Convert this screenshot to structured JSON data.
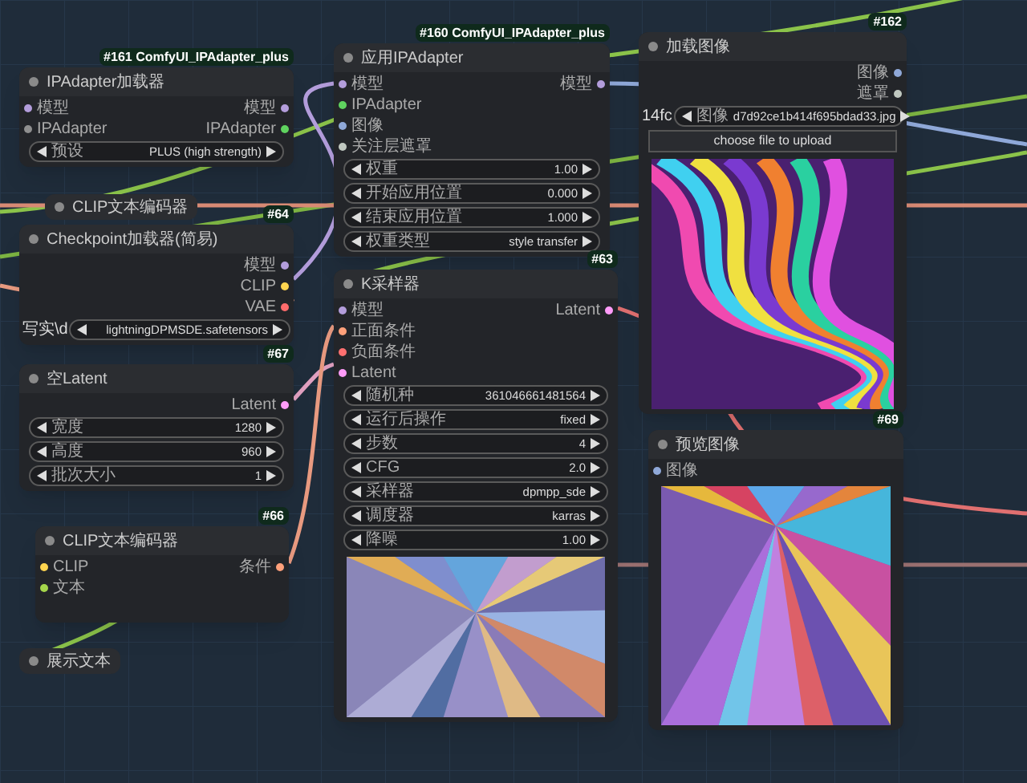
{
  "nodes": [
    {
      "kind": "node",
      "badge": "#161 ComfyUI_IPAdapter_plus",
      "title": "IPAdapter加载器",
      "inputs": [
        {
          "label": "模型",
          "color": "#b39ddb"
        },
        {
          "label": "IPAdapter",
          "color": "#8f8f8f"
        }
      ],
      "outputs": [
        {
          "label": "模型",
          "color": "#b39ddb"
        },
        {
          "label": "IPAdapter",
          "color": "#5fd35f"
        }
      ],
      "widgets": [
        {
          "label": "预设",
          "value": "PLUS (high strength)"
        }
      ]
    },
    {
      "kind": "node",
      "badge": "#160 ComfyUI_IPAdapter_plus",
      "title": "应用IPAdapter",
      "inputs": [
        {
          "label": "模型",
          "color": "#b39ddb"
        },
        {
          "label": "IPAdapter",
          "color": "#5fd35f"
        },
        {
          "label": "图像",
          "color": "#8fa8d8"
        },
        {
          "label": "关注层遮罩",
          "color": "#c0c8c0"
        }
      ],
      "outputs": [
        {
          "label": "模型",
          "color": "#b39ddb"
        }
      ],
      "widgets": [
        {
          "label": "权重",
          "value": "1.00"
        },
        {
          "label": "开始应用位置",
          "value": "0.000"
        },
        {
          "label": "结束应用位置",
          "value": "1.000"
        },
        {
          "label": "权重类型",
          "value": "style transfer"
        }
      ]
    },
    {
      "kind": "node",
      "badge": "#162",
      "title": "加载图像",
      "outputs": [
        {
          "label": "图像",
          "color": "#8fa8d8"
        },
        {
          "label": "遮罩",
          "color": "#c0c8c0"
        }
      ],
      "widgets": [
        {
          "prefix": "14fc",
          "label": "图像",
          "value": "d7d92ce1b414f695bdad33.jpg"
        }
      ],
      "button": "choose file to upload",
      "image": {
        "kind": "picture"
      }
    },
    {
      "kind": "collapsed",
      "title": "CLIP文本编码器"
    },
    {
      "kind": "node",
      "badge": "#64",
      "title": "Checkpoint加载器(简易)",
      "outputs": [
        {
          "label": "模型",
          "color": "#b39ddb"
        },
        {
          "label": "CLIP",
          "color": "#ffd54f"
        },
        {
          "label": "VAE",
          "color": "#ff6b6b"
        }
      ],
      "widgets": [
        {
          "prefix": "写实\\d",
          "value": "lightningDPMSDE.safetensors"
        }
      ]
    },
    {
      "kind": "node",
      "badge": "#67",
      "title": "空Latent",
      "outputs": [
        {
          "label": "Latent",
          "color": "#ff9cf9"
        }
      ],
      "widgets": [
        {
          "label": "宽度",
          "value": "1280"
        },
        {
          "label": "高度",
          "value": "960"
        },
        {
          "label": "批次大小",
          "value": "1"
        }
      ]
    },
    {
      "kind": "node",
      "badge": "#66",
      "title": "CLIP文本编码器",
      "inputs": [
        {
          "label": "CLIP",
          "color": "#ffd54f"
        },
        {
          "label": "文本",
          "color": "#a5d64b"
        }
      ],
      "outputs": [
        {
          "label": "条件",
          "color": "#ffa07a"
        }
      ]
    },
    {
      "kind": "collapsed",
      "title": "展示文本"
    },
    {
      "kind": "node",
      "badge": "#63",
      "title": "K采样器",
      "inputs": [
        {
          "label": "模型",
          "color": "#b39ddb"
        },
        {
          "label": "正面条件",
          "color": "#ffa07a"
        },
        {
          "label": "负面条件",
          "color": "#ff7070"
        },
        {
          "label": "Latent",
          "color": "#ff9cf9"
        }
      ],
      "outputs": [
        {
          "label": "Latent",
          "color": "#ff9cf9"
        }
      ],
      "widgets": [
        {
          "label": "随机种",
          "value": "361046661481564"
        },
        {
          "label": "运行后操作",
          "value": "fixed"
        },
        {
          "label": "步数",
          "value": "4"
        },
        {
          "label": "CFG",
          "value": "2.0"
        },
        {
          "label": "采样器",
          "value": "dpmpp_sde"
        },
        {
          "label": "调度器",
          "value": "karras"
        },
        {
          "label": "降噪",
          "value": "1.00"
        }
      ],
      "image": {
        "kind": "picture"
      }
    },
    {
      "kind": "node",
      "badge": "#69",
      "title": "预览图像",
      "inputs": [
        {
          "label": "图像",
          "color": "#8fa8d8"
        }
      ],
      "image": {
        "kind": "picture"
      }
    }
  ]
}
